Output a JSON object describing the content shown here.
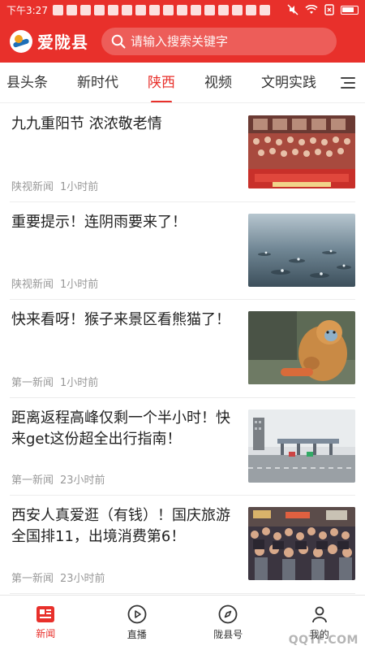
{
  "status_bar": {
    "time": "下午3:27",
    "icons": [
      "mute-icon",
      "wifi-icon",
      "sim-x-icon",
      "battery-icon"
    ]
  },
  "header": {
    "app_name": "爱陇县",
    "search_placeholder": "请输入搜索关键字"
  },
  "tabs": [
    {
      "label": "县头条",
      "active": false
    },
    {
      "label": "新时代",
      "active": false
    },
    {
      "label": "陕西",
      "active": true
    },
    {
      "label": "视频",
      "active": false
    },
    {
      "label": "文明实践",
      "active": false
    }
  ],
  "news": [
    {
      "title": "九九重阳节 浓浓敬老情",
      "source": "陕视新闻",
      "time": "1小时前",
      "thumb": "festival-hall-photo"
    },
    {
      "title": "重要提示！连阴雨要来了！",
      "source": "陕视新闻",
      "time": "1小时前",
      "thumb": "rain-water-photo"
    },
    {
      "title": "快来看呀！猴子来景区看熊猫了！",
      "source": "第一新闻",
      "time": "1小时前",
      "thumb": "golden-monkey-photo"
    },
    {
      "title": "距离返程高峰仅剩一个半小时！快来get这份超全出行指南！",
      "source": "第一新闻",
      "time": "23小时前",
      "thumb": "toll-station-photo"
    },
    {
      "title": "西安人真爱逛（有钱）！国庆旅游全国排11，出境消费第6！",
      "source": "第一新闻",
      "time": "23小时前",
      "thumb": "crowd-street-photo"
    }
  ],
  "bottom_nav": [
    {
      "label": "新闻",
      "icon": "news-icon",
      "active": true
    },
    {
      "label": "直播",
      "icon": "play-circle-icon",
      "active": false
    },
    {
      "label": "陇县号",
      "icon": "compass-icon",
      "active": false
    },
    {
      "label": "我的",
      "icon": "user-icon",
      "active": false
    }
  ],
  "watermark": "QQTF.COM",
  "colors": {
    "accent": "#e8302b",
    "header_bg": "#e8302b",
    "meta_text": "#999999"
  }
}
